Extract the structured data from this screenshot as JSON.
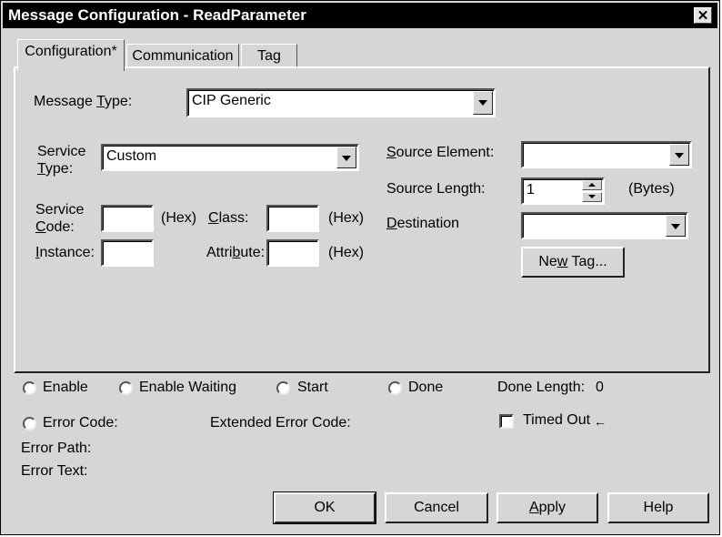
{
  "window": {
    "title": "Message Configuration - ReadParameter",
    "close_glyph": "✕"
  },
  "tabs": [
    {
      "label": "Configuration*"
    },
    {
      "label": "Communication"
    },
    {
      "label": "Tag"
    }
  ],
  "config": {
    "message_type": {
      "label_pre": "Message ",
      "label_u": "T",
      "label_post": "ype:",
      "value": "CIP Generic"
    },
    "service_type": {
      "label_line1": "Service",
      "label_u": "T",
      "label_post": "ype:",
      "value": "Custom"
    },
    "service_code": {
      "label_line1": "Service",
      "label_u": "C",
      "label_post": "ode:",
      "value": "",
      "unit": "(Hex)"
    },
    "class": {
      "label_u": "C",
      "label_post": "lass:",
      "value": "",
      "unit": "(Hex)"
    },
    "instance": {
      "label_u": "I",
      "label_post": "nstance:",
      "value": "",
      "unit": ""
    },
    "attribute": {
      "label_pre": "Attri",
      "label_u": "b",
      "label_post": "ute:",
      "value": "",
      "unit": "(Hex)"
    },
    "source_element": {
      "label_u": "S",
      "label_post": "ource Element:",
      "value": ""
    },
    "source_length": {
      "label_pre": "Source Len",
      "label_u": "g",
      "label_post": "th:",
      "value": "1",
      "unit": "(Bytes)"
    },
    "destination": {
      "label_u": "D",
      "label_post": "estination",
      "value": ""
    },
    "new_tag": {
      "label_pre": "Ne",
      "label_u": "w",
      "label_post": " Tag..."
    }
  },
  "status": {
    "enable": "Enable",
    "enable_waiting": "Enable Waiting",
    "start": "Start",
    "done": "Done",
    "done_length_label": "Done Length:",
    "done_length_value": "0",
    "error_code": "Error Code:",
    "extended_error_code": "Extended Error Code:",
    "timed_out": "Timed Out",
    "timed_out_arrow": "←",
    "error_path": "Error Path:",
    "error_text": "Error Text:"
  },
  "buttons": {
    "ok": "OK",
    "cancel": "Cancel",
    "apply_u": "A",
    "apply_post": "pply",
    "help": "Help"
  }
}
